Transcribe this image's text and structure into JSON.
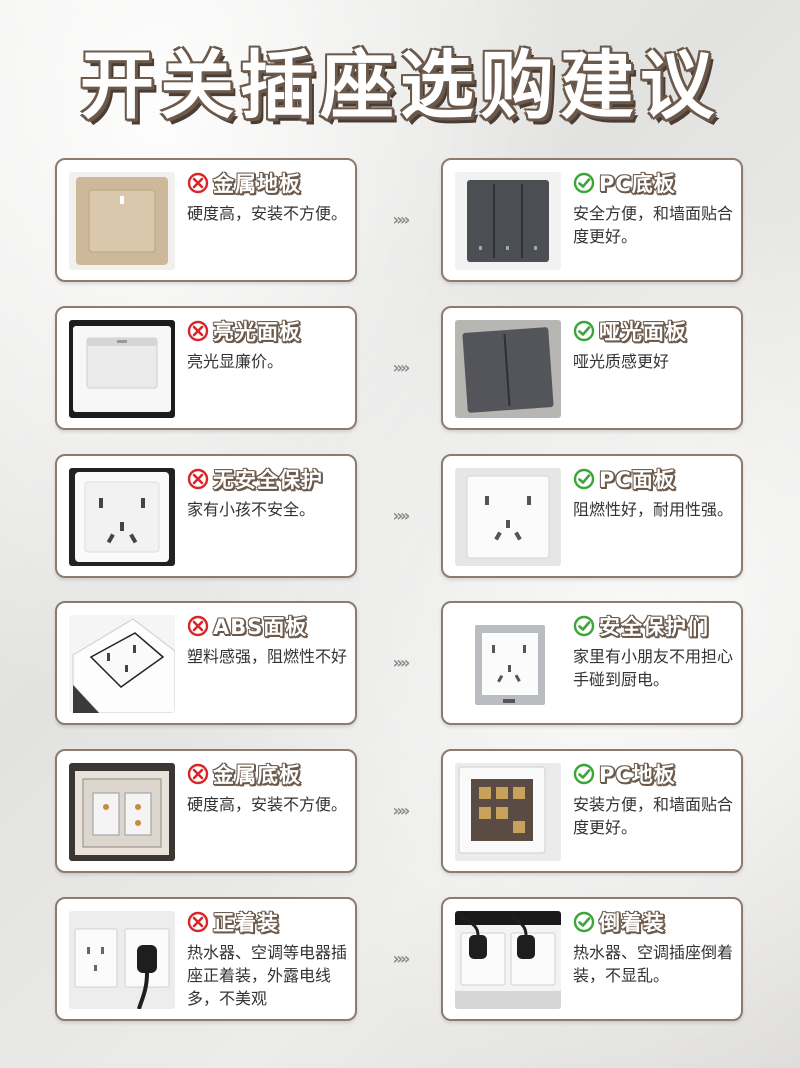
{
  "title": "开关插座选购建议",
  "arrow_glyph": "»»",
  "rows": [
    {
      "bad": {
        "label": "金属地板",
        "desc": "硬度高，安装不方便。",
        "icon": "cross-circle-icon",
        "image": "champagne-gold-switch-photo"
      },
      "good": {
        "label": "PC底板",
        "desc": "安全方便，和墙面贴合度更好。",
        "icon": "check-circle-icon",
        "image": "dark-gray-triple-switch-photo"
      }
    },
    {
      "bad": {
        "label": "亮光面板",
        "desc": "亮光显廉价。",
        "icon": "cross-circle-icon",
        "image": "glossy-white-switch-photo"
      },
      "good": {
        "label": "哑光面板",
        "desc": "哑光质感更好",
        "icon": "check-circle-icon",
        "image": "matte-gray-double-switch-photo"
      }
    },
    {
      "bad": {
        "label": "无安全保护",
        "desc": "家有小孩不安全。",
        "icon": "cross-circle-icon",
        "image": "white-five-hole-socket-photo"
      },
      "good": {
        "label": "PC面板",
        "desc": "阻燃性好，耐用性强。",
        "icon": "check-circle-icon",
        "image": "white-pc-socket-photo"
      }
    },
    {
      "bad": {
        "label": "ABS面板",
        "desc": "塑料感强，阻燃性不好",
        "icon": "cross-circle-icon",
        "image": "abs-socket-angled-photo"
      },
      "good": {
        "label": "安全保护们",
        "desc": "家里有小朋友不用担心手碰到厨电。",
        "icon": "check-circle-icon",
        "image": "silver-frame-socket-photo"
      }
    },
    {
      "bad": {
        "label": "金属底板",
        "desc": "硬度高，安装不方便。",
        "icon": "cross-circle-icon",
        "image": "metal-back-plate-photo"
      },
      "good": {
        "label": "PC地板",
        "desc": "安装方便，和墙面贴合度更好。",
        "icon": "check-circle-icon",
        "image": "pc-back-plate-photo"
      }
    },
    {
      "bad": {
        "label": "正着装",
        "desc": "热水器、空调等电器插座正着装，外露电线多，不美观",
        "icon": "cross-circle-icon",
        "image": "upright-plug-socket-photo"
      },
      "good": {
        "label": "倒着装",
        "desc": "热水器、空调插座倒着装，不显乱。",
        "icon": "check-circle-icon",
        "image": "inverted-plug-socket-photo"
      }
    }
  ]
}
